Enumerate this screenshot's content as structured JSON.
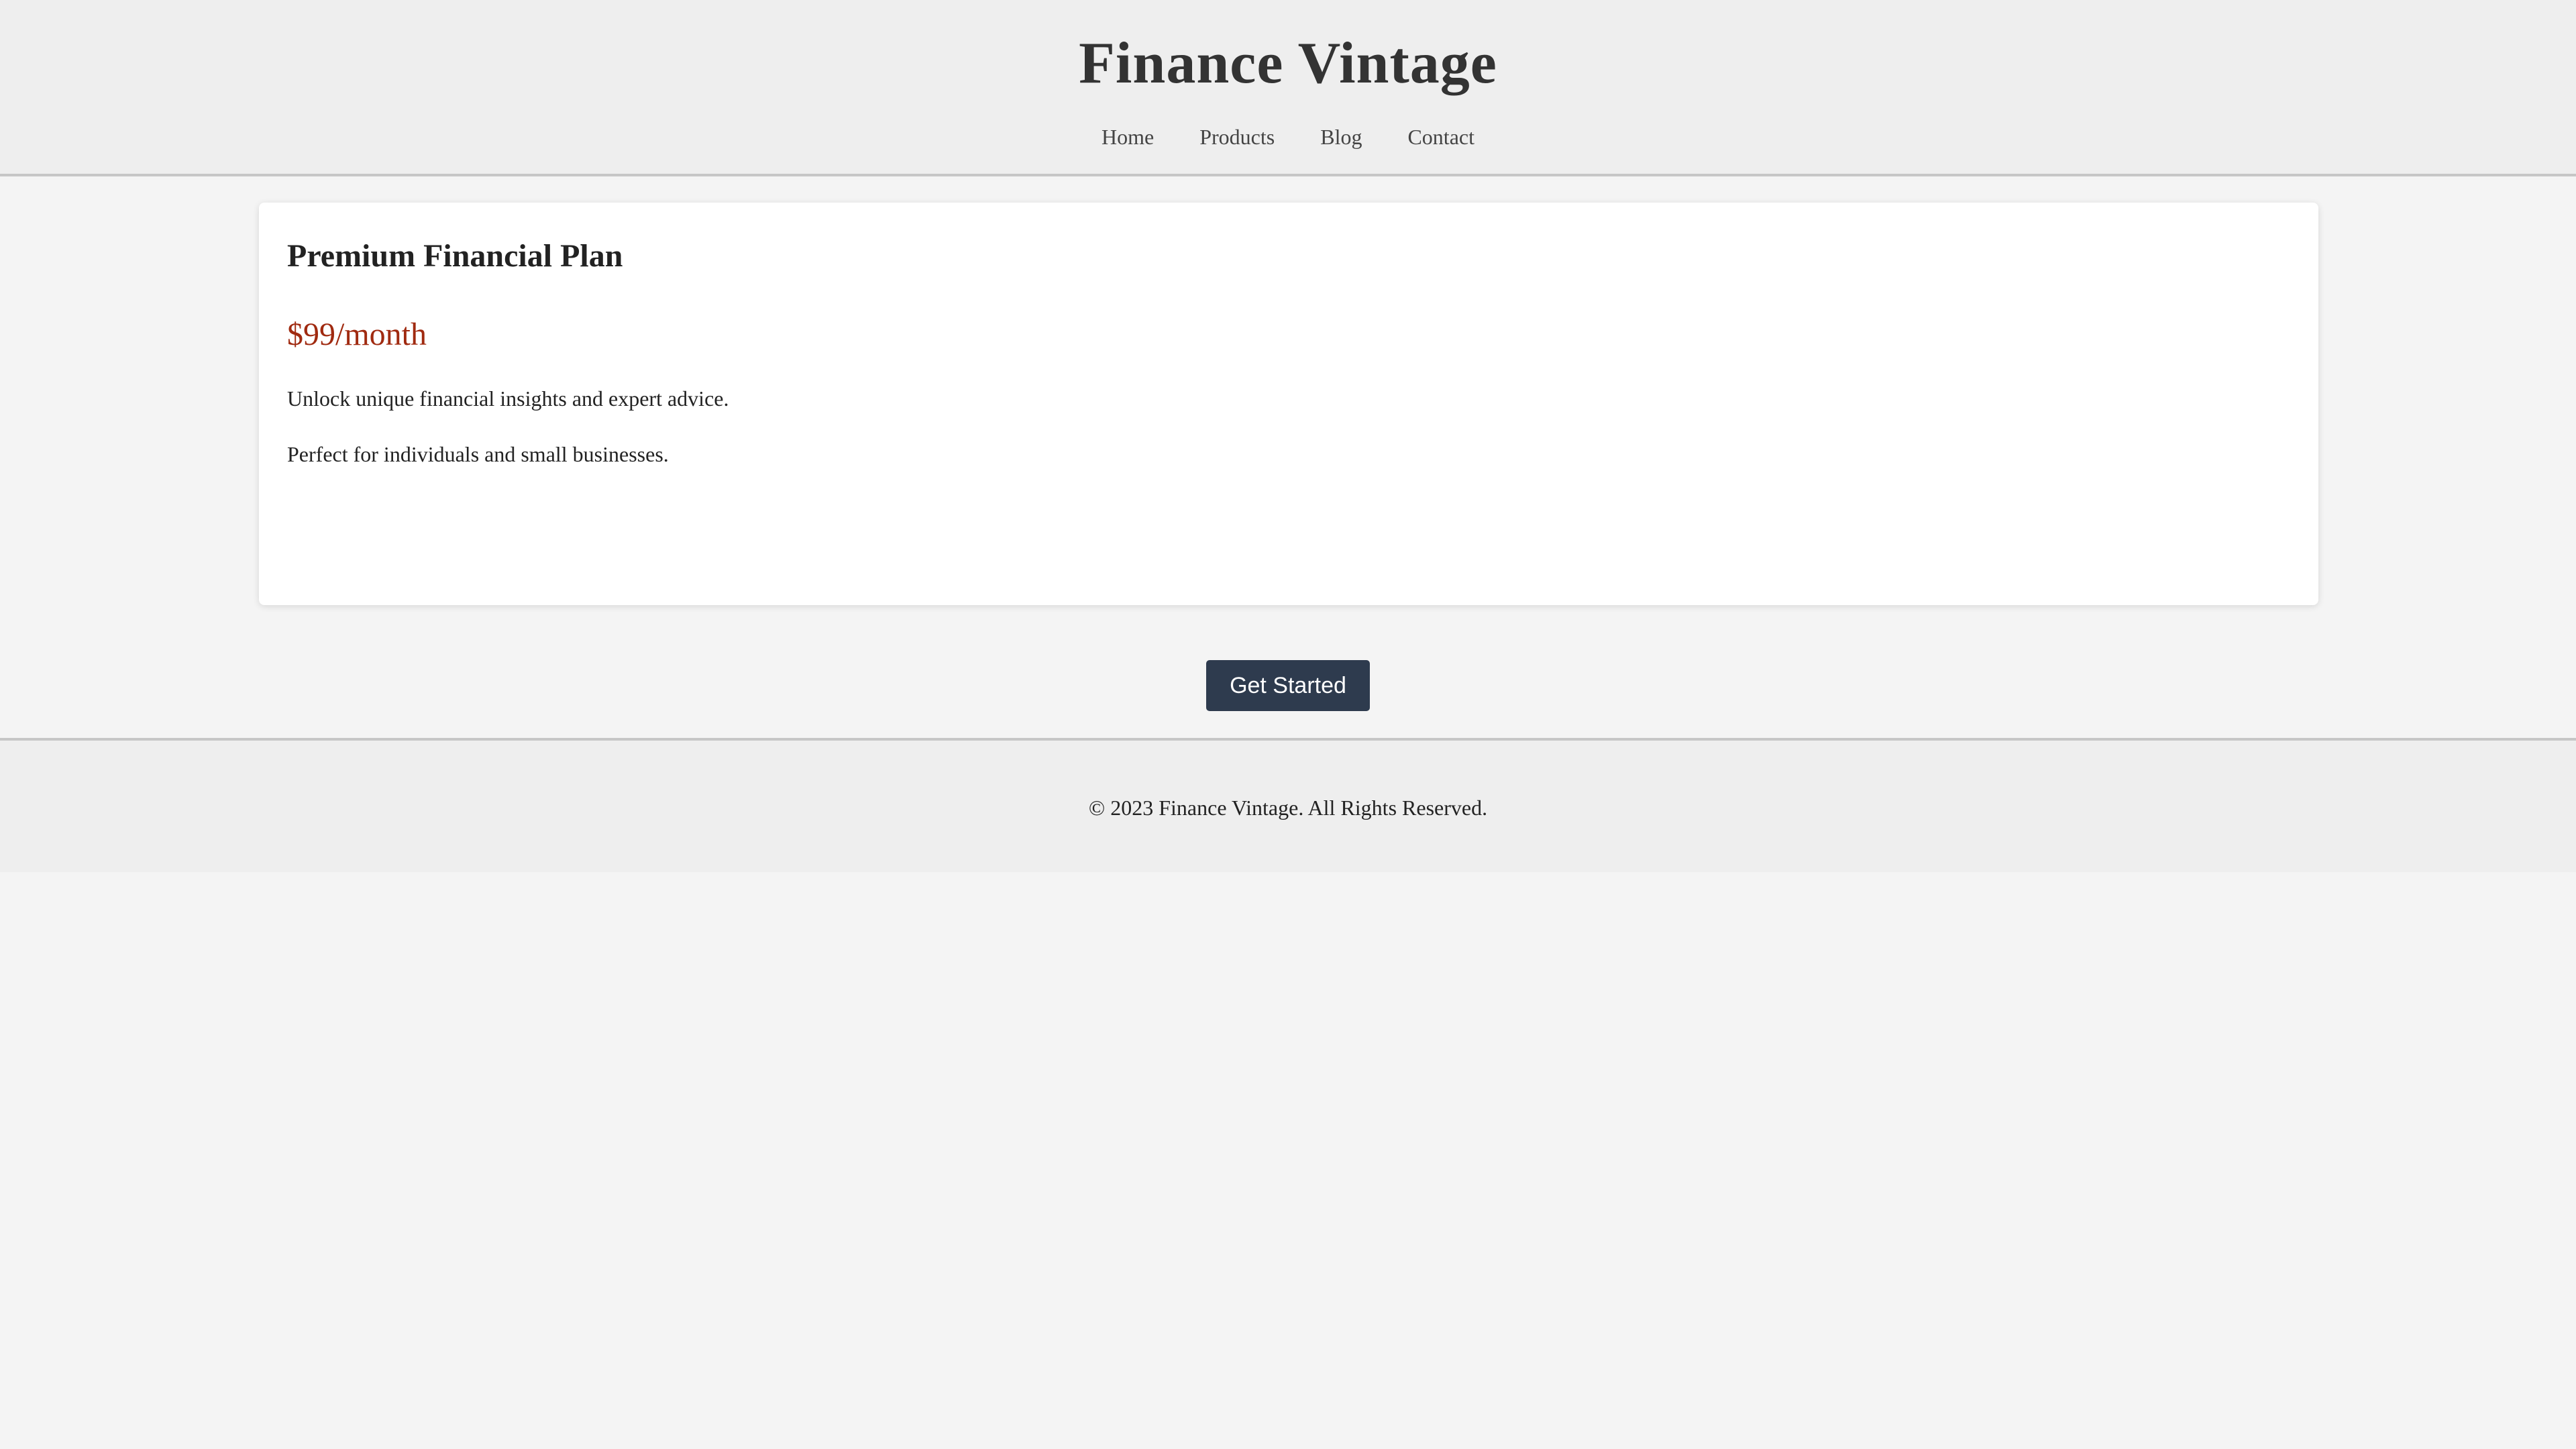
{
  "header": {
    "title": "Finance Vintage",
    "nav": [
      {
        "label": "Home"
      },
      {
        "label": "Products"
      },
      {
        "label": "Blog"
      },
      {
        "label": "Contact"
      }
    ]
  },
  "plan": {
    "title": "Premium Financial Plan",
    "price": "$99/month",
    "description_1": "Unlock unique financial insights and expert advice.",
    "description_2": "Perfect for individuals and small businesses."
  },
  "cta": {
    "label": "Get Started"
  },
  "footer": {
    "text": "© 2023 Finance Vintage. All Rights Reserved."
  },
  "colors": {
    "background": "#f4f4f4",
    "header_background": "#eeeeee",
    "price_accent": "#a02a10",
    "button_background": "#2e3b4e",
    "button_text": "#ffffff"
  }
}
